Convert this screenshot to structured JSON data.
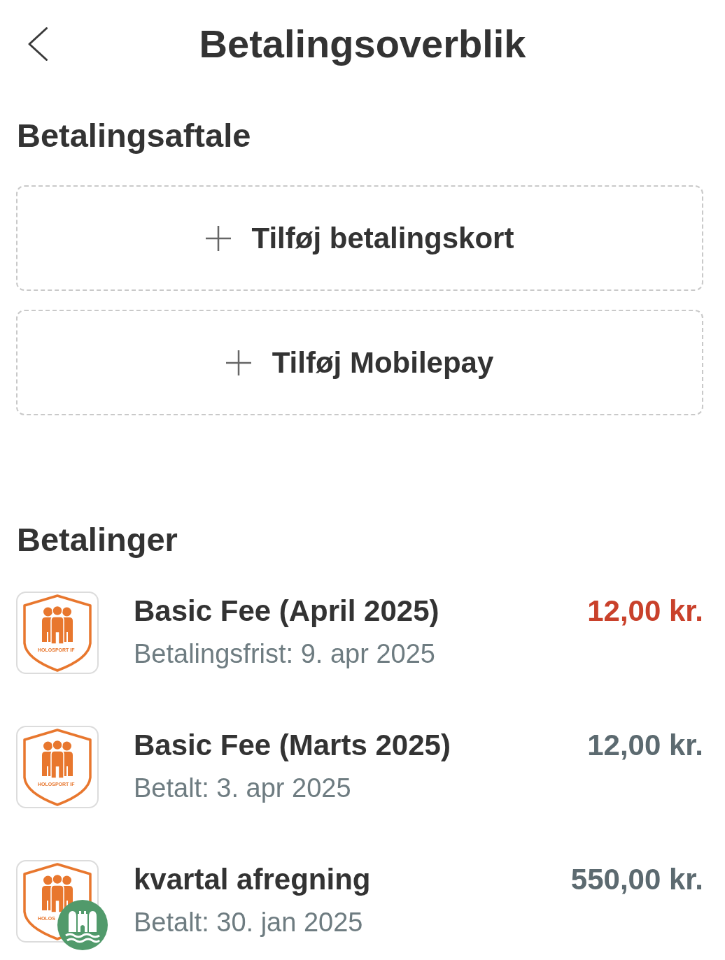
{
  "header": {
    "title": "Betalingsoverblik"
  },
  "agreement": {
    "heading": "Betalingsaftale",
    "add_buttons": [
      {
        "label": "Tilføj betalingskort"
      },
      {
        "label": "Tilføj Mobilepay"
      }
    ]
  },
  "payments": {
    "heading": "Betalinger",
    "items": [
      {
        "title": "Basic Fee (April 2025)",
        "detail": "Betalingsfrist: 9. apr 2025",
        "amount": "12,00 kr.",
        "overdue": true,
        "logo_text": "HOLOSPORT IF",
        "has_badge": false
      },
      {
        "title": "Basic Fee (Marts 2025)",
        "detail": "Betalt: 3. apr 2025",
        "amount": "12,00 kr.",
        "overdue": false,
        "logo_text": "HOLOSPORT IF",
        "has_badge": false
      },
      {
        "title": "kvartal afregning",
        "detail": "Betalt: 30. jan 2025",
        "amount": "550,00 kr.",
        "overdue": false,
        "logo_text": "HOLOS",
        "has_badge": true
      }
    ]
  }
}
